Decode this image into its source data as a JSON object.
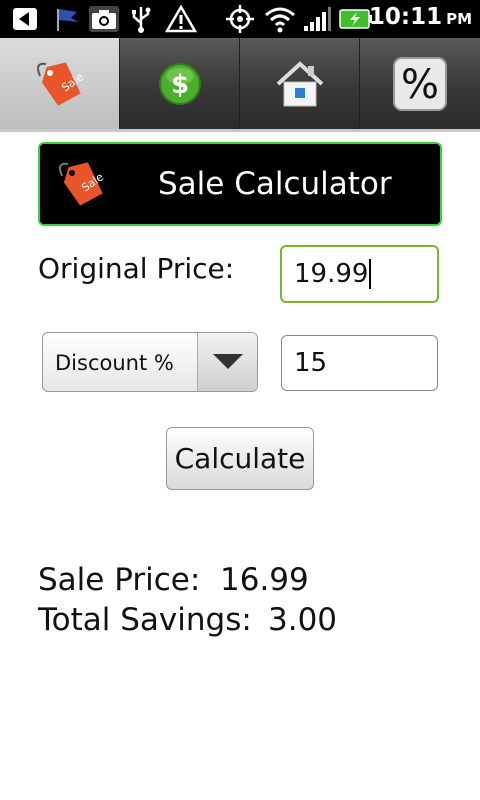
{
  "status_bar": {
    "time": "10:11",
    "ampm": "PM",
    "icons": [
      "back-icon",
      "flag-icon",
      "camera-icon",
      "usb-icon",
      "warning-icon",
      "gps-icon",
      "wifi-icon",
      "signal-icon",
      "battery-icon"
    ]
  },
  "tabs": [
    {
      "icon": "sale-tag-icon",
      "selected": true
    },
    {
      "icon": "dollar-icon",
      "selected": false
    },
    {
      "icon": "home-icon",
      "selected": false
    },
    {
      "icon": "percent-icon",
      "selected": false
    }
  ],
  "header": {
    "title": "Sale Calculator",
    "tag_text": "Sale"
  },
  "form": {
    "original_price_label": "Original Price:",
    "original_price_value": "19.99",
    "discount_type": "Discount %",
    "discount_value": "15",
    "calculate_label": "Calculate"
  },
  "results": {
    "sale_price_label": "Sale Price:",
    "sale_price_value": "16.99",
    "total_savings_label": "Total Savings:",
    "total_savings_value": "3.00"
  },
  "colors": {
    "accent_green": "#3bd13b",
    "focus_green": "#7ab536",
    "tag_orange": "#e8552a"
  }
}
